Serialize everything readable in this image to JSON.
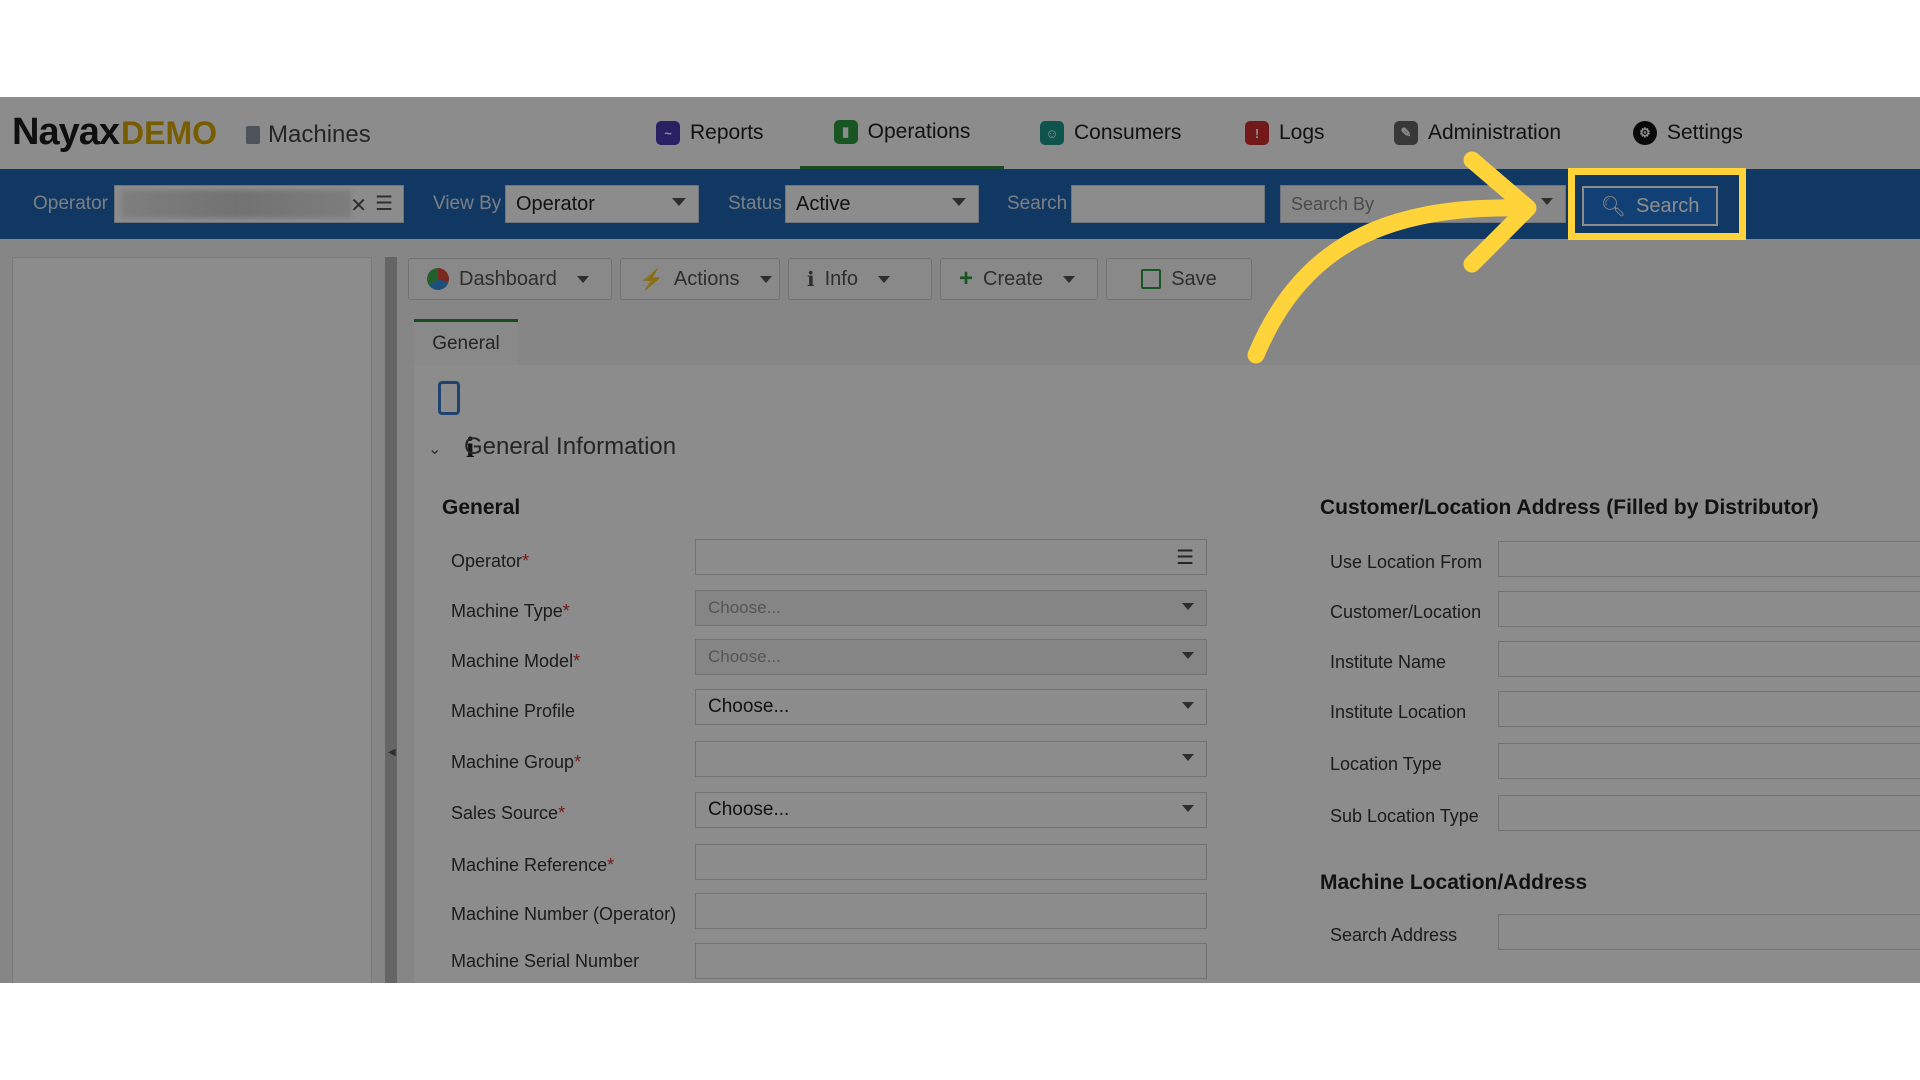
{
  "header": {
    "logo_main": "Nayax",
    "logo_demo": "DEMO",
    "module_name": "Machines",
    "nav": [
      {
        "label": "Reports",
        "icon": "reports-icon"
      },
      {
        "label": "Operations",
        "icon": "operations-icon"
      },
      {
        "label": "Consumers",
        "icon": "consumers-icon"
      },
      {
        "label": "Logs",
        "icon": "logs-icon"
      },
      {
        "label": "Administration",
        "icon": "administration-icon"
      },
      {
        "label": "Settings",
        "icon": "settings-icon"
      }
    ],
    "active_nav": "Operations"
  },
  "toolbar": {
    "operator_label": "Operator",
    "view_by_label": "View By",
    "view_by_value": "Operator",
    "status_label": "Status",
    "status_value": "Active",
    "search_label": "Search",
    "search_value": "",
    "search_by_placeholder": "Search By",
    "search_button": "Search"
  },
  "actions": {
    "dashboard": "Dashboard",
    "actions": "Actions",
    "info": "Info",
    "create": "Create",
    "save": "Save"
  },
  "tabs": {
    "general": "General"
  },
  "section": {
    "title": "General Information",
    "left_heading": "General",
    "right_heading": "Customer/Location Address (Filled by Distributor)",
    "right_heading_2": "Machine Location/Address"
  },
  "left_fields": [
    {
      "label": "Operator",
      "required": "*",
      "value": ""
    },
    {
      "label": "Machine Type",
      "required": "*",
      "value": "Choose..."
    },
    {
      "label": "Machine Model",
      "required": "*",
      "value": "Choose..."
    },
    {
      "label": "Machine Profile",
      "required": "",
      "value": "Choose..."
    },
    {
      "label": "Machine Group",
      "required": "*",
      "value": ""
    },
    {
      "label": "Sales Source",
      "required": "*",
      "value": "Choose..."
    },
    {
      "label": "Machine Reference",
      "required": "*",
      "value": ""
    },
    {
      "label": "Machine Number (Operator)",
      "required": "",
      "value": ""
    },
    {
      "label": "Machine Serial Number",
      "required": "",
      "value": ""
    }
  ],
  "right_fields": [
    {
      "label": "Use Location From"
    },
    {
      "label": "Customer/Location"
    },
    {
      "label": "Institute Name"
    },
    {
      "label": "Institute Location"
    },
    {
      "label": "Location Type"
    },
    {
      "label": "Sub Location Type"
    },
    {
      "label": "Search Address"
    }
  ],
  "colors": {
    "toolbar": "#1f66b3",
    "accent": "#2e8b3a",
    "highlight": "#ffd43b",
    "search_button": "#2476d3"
  }
}
